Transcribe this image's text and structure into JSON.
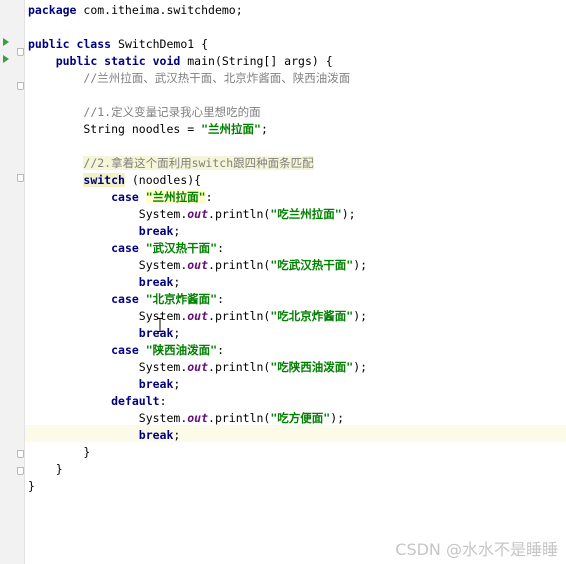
{
  "editor": {
    "lines": [
      [
        {
          "t": "package",
          "c": "kw"
        },
        {
          "t": " com.itheima.switchdemo;"
        }
      ],
      [],
      [
        {
          "t": "public class",
          "c": "kw"
        },
        {
          "t": " SwitchDemo1 {"
        }
      ],
      [
        {
          "t": "    "
        },
        {
          "t": "public static void",
          "c": "kw"
        },
        {
          "t": " main(String[] args) {"
        }
      ],
      [
        {
          "t": "        "
        },
        {
          "t": "//兰州拉面、武汉热干面、北京炸酱面、陕西油泼面",
          "c": "cmt"
        }
      ],
      [],
      [
        {
          "t": "        "
        },
        {
          "t": "//1.定义变量记录我心里想吃的面",
          "c": "cmt"
        }
      ],
      [
        {
          "t": "        String noodles = "
        },
        {
          "t": "\"兰州拉面\"",
          "c": "str"
        },
        {
          "t": ";"
        }
      ],
      [],
      [
        {
          "t": "        "
        },
        {
          "t": "//2.拿着这个面利用switch跟四种面条匹配",
          "c": "cmt-hl"
        }
      ],
      [
        {
          "t": "        "
        },
        {
          "t": "switch",
          "c": "kw sw-hl"
        },
        {
          "t": " (noodles){"
        }
      ],
      [
        {
          "t": "            "
        },
        {
          "t": "case",
          "c": "kw"
        },
        {
          "t": " "
        },
        {
          "t": "\"兰州拉面\"",
          "c": "str str-hl"
        },
        {
          "t": ":"
        }
      ],
      [
        {
          "t": "                System."
        },
        {
          "t": "out",
          "c": "fld"
        },
        {
          "t": ".println("
        },
        {
          "t": "\"吃兰州拉面\"",
          "c": "str"
        },
        {
          "t": ");"
        }
      ],
      [
        {
          "t": "                "
        },
        {
          "t": "break",
          "c": "kw"
        },
        {
          "t": ";"
        }
      ],
      [
        {
          "t": "            "
        },
        {
          "t": "case",
          "c": "kw"
        },
        {
          "t": " "
        },
        {
          "t": "\"武汉热干面\"",
          "c": "str"
        },
        {
          "t": ":"
        }
      ],
      [
        {
          "t": "                System."
        },
        {
          "t": "out",
          "c": "fld"
        },
        {
          "t": ".println("
        },
        {
          "t": "\"吃武汉热干面\"",
          "c": "str"
        },
        {
          "t": ");"
        }
      ],
      [
        {
          "t": "                "
        },
        {
          "t": "break",
          "c": "kw"
        },
        {
          "t": ";"
        }
      ],
      [
        {
          "t": "            "
        },
        {
          "t": "case",
          "c": "kw"
        },
        {
          "t": " "
        },
        {
          "t": "\"北京炸酱面\"",
          "c": "str"
        },
        {
          "t": ":"
        }
      ],
      [
        {
          "t": "                System."
        },
        {
          "t": "out",
          "c": "fld"
        },
        {
          "t": ".println("
        },
        {
          "t": "\"吃北京炸酱面\"",
          "c": "str"
        },
        {
          "t": ");"
        }
      ],
      [
        {
          "t": "                "
        },
        {
          "t": "break",
          "c": "kw"
        },
        {
          "t": ";"
        }
      ],
      [
        {
          "t": "            "
        },
        {
          "t": "case",
          "c": "kw"
        },
        {
          "t": " "
        },
        {
          "t": "\"陕西油泼面\"",
          "c": "str"
        },
        {
          "t": ":"
        }
      ],
      [
        {
          "t": "                System."
        },
        {
          "t": "out",
          "c": "fld"
        },
        {
          "t": ".println("
        },
        {
          "t": "\"吃陕西油泼面\"",
          "c": "str"
        },
        {
          "t": ");"
        }
      ],
      [
        {
          "t": "                "
        },
        {
          "t": "break",
          "c": "kw"
        },
        {
          "t": ";"
        }
      ],
      [
        {
          "t": "            "
        },
        {
          "t": "default",
          "c": "kw"
        },
        {
          "t": ":"
        }
      ],
      [
        {
          "t": "                System."
        },
        {
          "t": "out",
          "c": "fld"
        },
        {
          "t": ".println("
        },
        {
          "t": "\"吃方便面\"",
          "c": "str"
        },
        {
          "t": ");"
        }
      ],
      [
        {
          "t": "                "
        },
        {
          "t": "break",
          "c": "kw"
        },
        {
          "t": ";"
        }
      ],
      [
        {
          "t": "        }"
        }
      ],
      [
        {
          "t": "    }"
        }
      ],
      [
        {
          "t": "}"
        }
      ]
    ]
  },
  "watermark": "CSDN @水水不是睡睡",
  "colors": {
    "keyword": "#000080",
    "string": "#008000",
    "comment": "#808080",
    "static_field": "#660e7a",
    "run_icon": "#3e9c3e",
    "current_line": "#fcfae8"
  },
  "icons": [
    "run-icon",
    "fold-icon",
    "mouse-i-beam-cursor"
  ]
}
